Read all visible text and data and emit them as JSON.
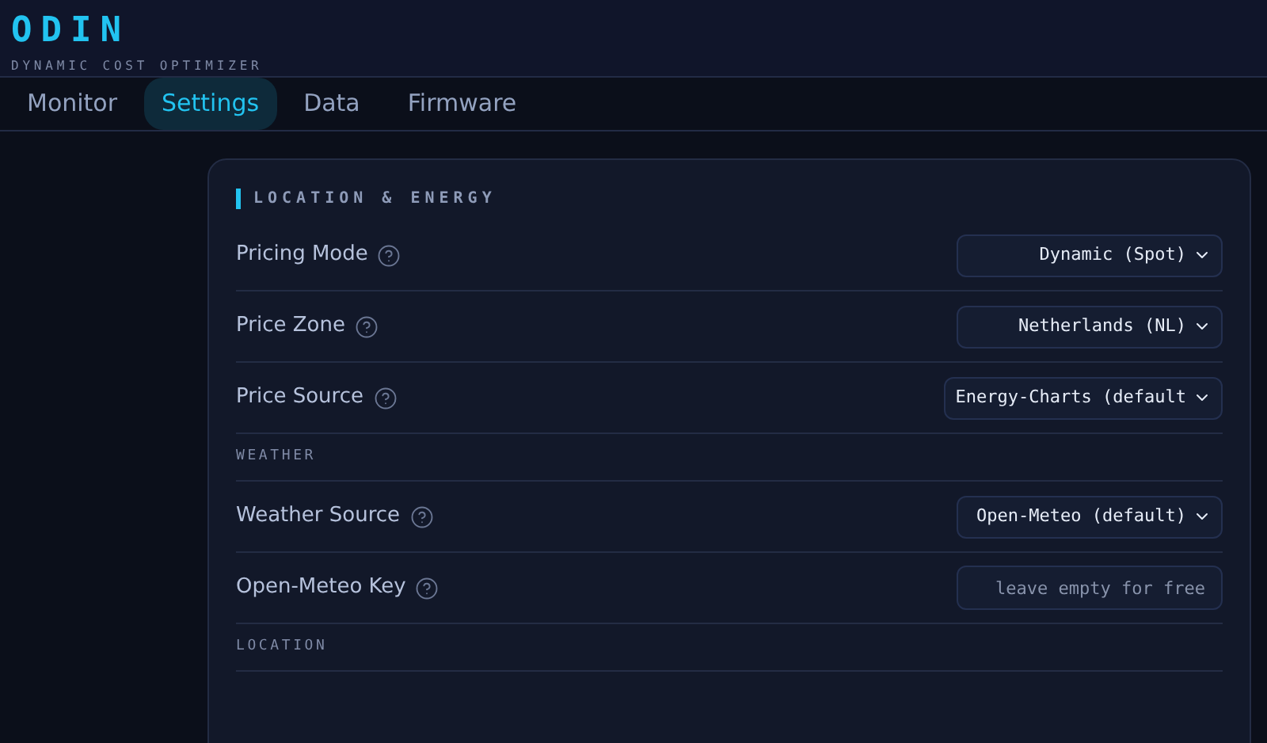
{
  "header": {
    "title": "ODIN",
    "subtitle": "DYNAMIC COST OPTIMIZER"
  },
  "tabs": [
    {
      "label": "Monitor",
      "selected": false
    },
    {
      "label": "Settings",
      "selected": true
    },
    {
      "label": "Data",
      "selected": false
    },
    {
      "label": "Firmware",
      "selected": false
    }
  ],
  "card": {
    "title": "LOCATION & ENERGY",
    "rows": [
      {
        "kind": "select",
        "label": "Pricing Mode",
        "value": "Dynamic (Spot)"
      },
      {
        "kind": "select",
        "label": "Price Zone",
        "value": "Netherlands (NL)"
      },
      {
        "kind": "select",
        "label": "Price Source",
        "value": "Energy-Charts (default"
      },
      {
        "kind": "section",
        "label": "WEATHER"
      },
      {
        "kind": "select",
        "label": "Weather Source",
        "value": "Open-Meteo (default)"
      },
      {
        "kind": "input",
        "label": "Open-Meteo Key",
        "placeholder": "leave empty for free"
      },
      {
        "kind": "section",
        "label": "LOCATION"
      }
    ]
  }
}
